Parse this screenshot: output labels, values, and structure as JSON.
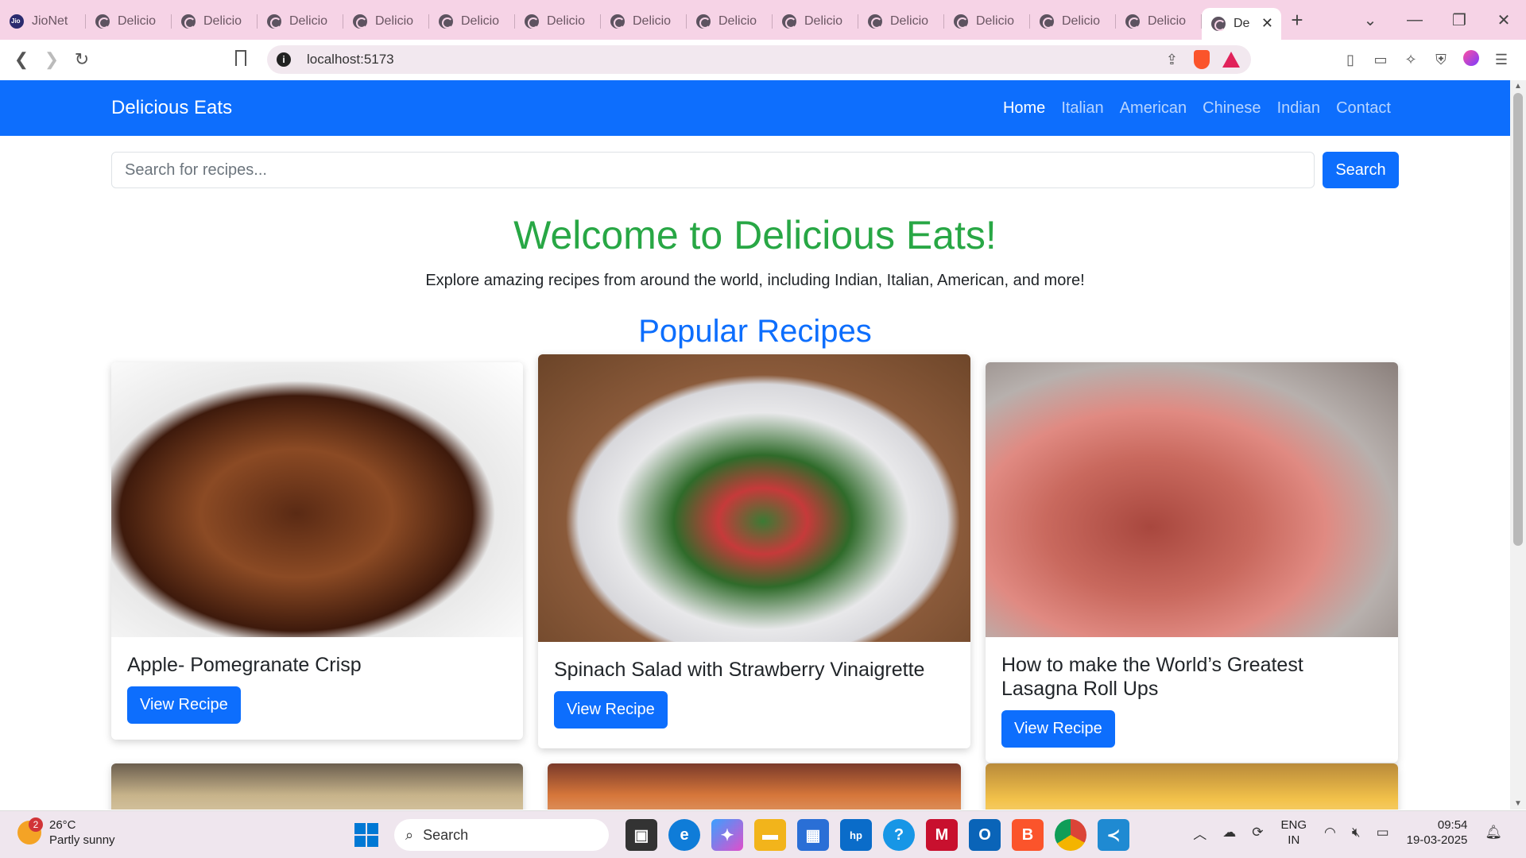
{
  "browser": {
    "tabs": [
      {
        "label": "JioNet",
        "icon": "jio-icon"
      },
      {
        "label": "Delicio"
      },
      {
        "label": "Delicio"
      },
      {
        "label": "Delicio"
      },
      {
        "label": "Delicio"
      },
      {
        "label": "Delicio"
      },
      {
        "label": "Delicio"
      },
      {
        "label": "Delicio"
      },
      {
        "label": "Delicio"
      },
      {
        "label": "Delicio"
      },
      {
        "label": "Delicio"
      },
      {
        "label": "Delicio"
      },
      {
        "label": "Delicio"
      },
      {
        "label": "Delicio"
      },
      {
        "label": "De",
        "active": true
      }
    ],
    "url": "localhost:5173",
    "new_tab": "+",
    "tab_close": "✕"
  },
  "site": {
    "brand": "Delicious Eats",
    "nav": [
      "Home",
      "Italian",
      "American",
      "Chinese",
      "Indian",
      "Contact"
    ],
    "active_nav": "Home",
    "search": {
      "placeholder": "Search for recipes...",
      "value": "",
      "button": "Search"
    },
    "hero_title": "Welcome to Delicious Eats!",
    "hero_subtitle": "Explore amazing recipes from around the world, including Indian, Italian, American, and more!",
    "section_title": "Popular Recipes",
    "recipes": [
      {
        "title": "Apple- Pomegranate Crisp",
        "button": "View Recipe"
      },
      {
        "title": "Spinach Salad with Strawberry Vinaigrette",
        "button": "View Recipe"
      },
      {
        "title": "How to make the World’s Greatest Lasagna Roll Ups",
        "button": "View Recipe"
      }
    ],
    "colors": {
      "primary": "#0d6efd",
      "hero_green": "#28a745"
    }
  },
  "taskbar": {
    "weather": {
      "temp": "26°C",
      "desc": "Partly sunny",
      "badge": "2"
    },
    "search": "Search",
    "lang": {
      "line1": "ENG",
      "line2": "IN"
    },
    "time": "09:54",
    "date": "19-03-2025"
  }
}
